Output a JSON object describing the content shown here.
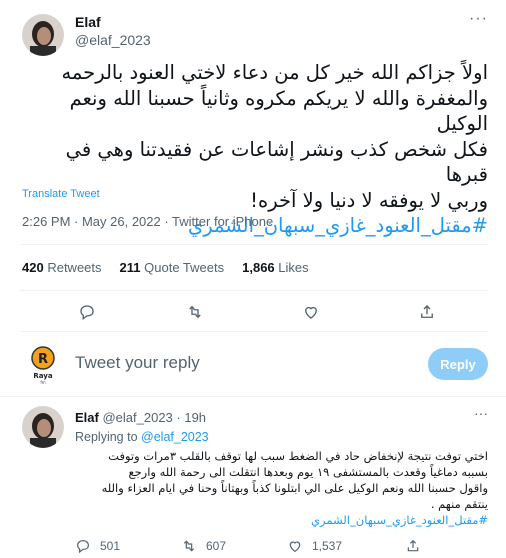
{
  "tweet": {
    "author_name": "Elaf",
    "author_handle": "@elaf_2023",
    "more": "···",
    "text_lines": [
      "اولاً جزاكم الله خير كل من دعاء لاختي العنود بالرحمه",
      "والمغفرة والله لا يريكم مكروه وثانياً حسبنا الله ونعم الوكيل",
      "فكل شخص كذب ونشر إشاعات عن فقيدتنا وهي في قبرها",
      "وربي لا يوفقه لا دنيا ولا آخره!"
    ],
    "hashtag": "#مقتل_العنود_غازي_سبهان_الشمري",
    "translate_label": "Translate Tweet",
    "meta": "2:26 PM · May 26, 2022 · Twitter for iPhone",
    "stats": [
      {
        "count": "420",
        "label": "Retweets"
      },
      {
        "count": "211",
        "label": "Quote Tweets"
      },
      {
        "count": "1,866",
        "label": "Likes"
      }
    ]
  },
  "composer": {
    "placeholder": "Tweet your reply",
    "avatar_text": "Raya",
    "avatar_sub": "fm",
    "reply_button": "Reply"
  },
  "reply_tweet": {
    "author_name": "Elaf",
    "author_handle": "@elaf_2023",
    "time": "· 19h",
    "more": "···",
    "replying_prefix": "Replying to",
    "replying_to": "@elaf_2023",
    "text_lines": [
      "اختي توفت نتيجة لإنخفاض حاد في الضغط سبب لها توقف بالقلب ٣مرات وتوفت",
      "بسببه دماغياً وقعدت بالمستشفى ١٩ يوم وبعدها انتقلت الى رحمة الله وارجع",
      "واقول حسبنا الله ونعم الوكيل على الي ابتلونا كذباً وبهتاناً وحنا في ايام العزاء والله",
      "ينتقم منهم ."
    ],
    "hashtag": "#مقتل_العنود_غازي_سبهان_الشمري",
    "actions": [
      {
        "icon": "reply-icon",
        "count": "501"
      },
      {
        "icon": "retweet-icon",
        "count": "607"
      },
      {
        "icon": "like-icon",
        "count": "1,537"
      },
      {
        "icon": "share-icon",
        "count": ""
      }
    ]
  },
  "colors": {
    "accent": "#1d9bf0",
    "reply_button_disabled": "#8ecdf8",
    "secondary_text": "#536471"
  }
}
